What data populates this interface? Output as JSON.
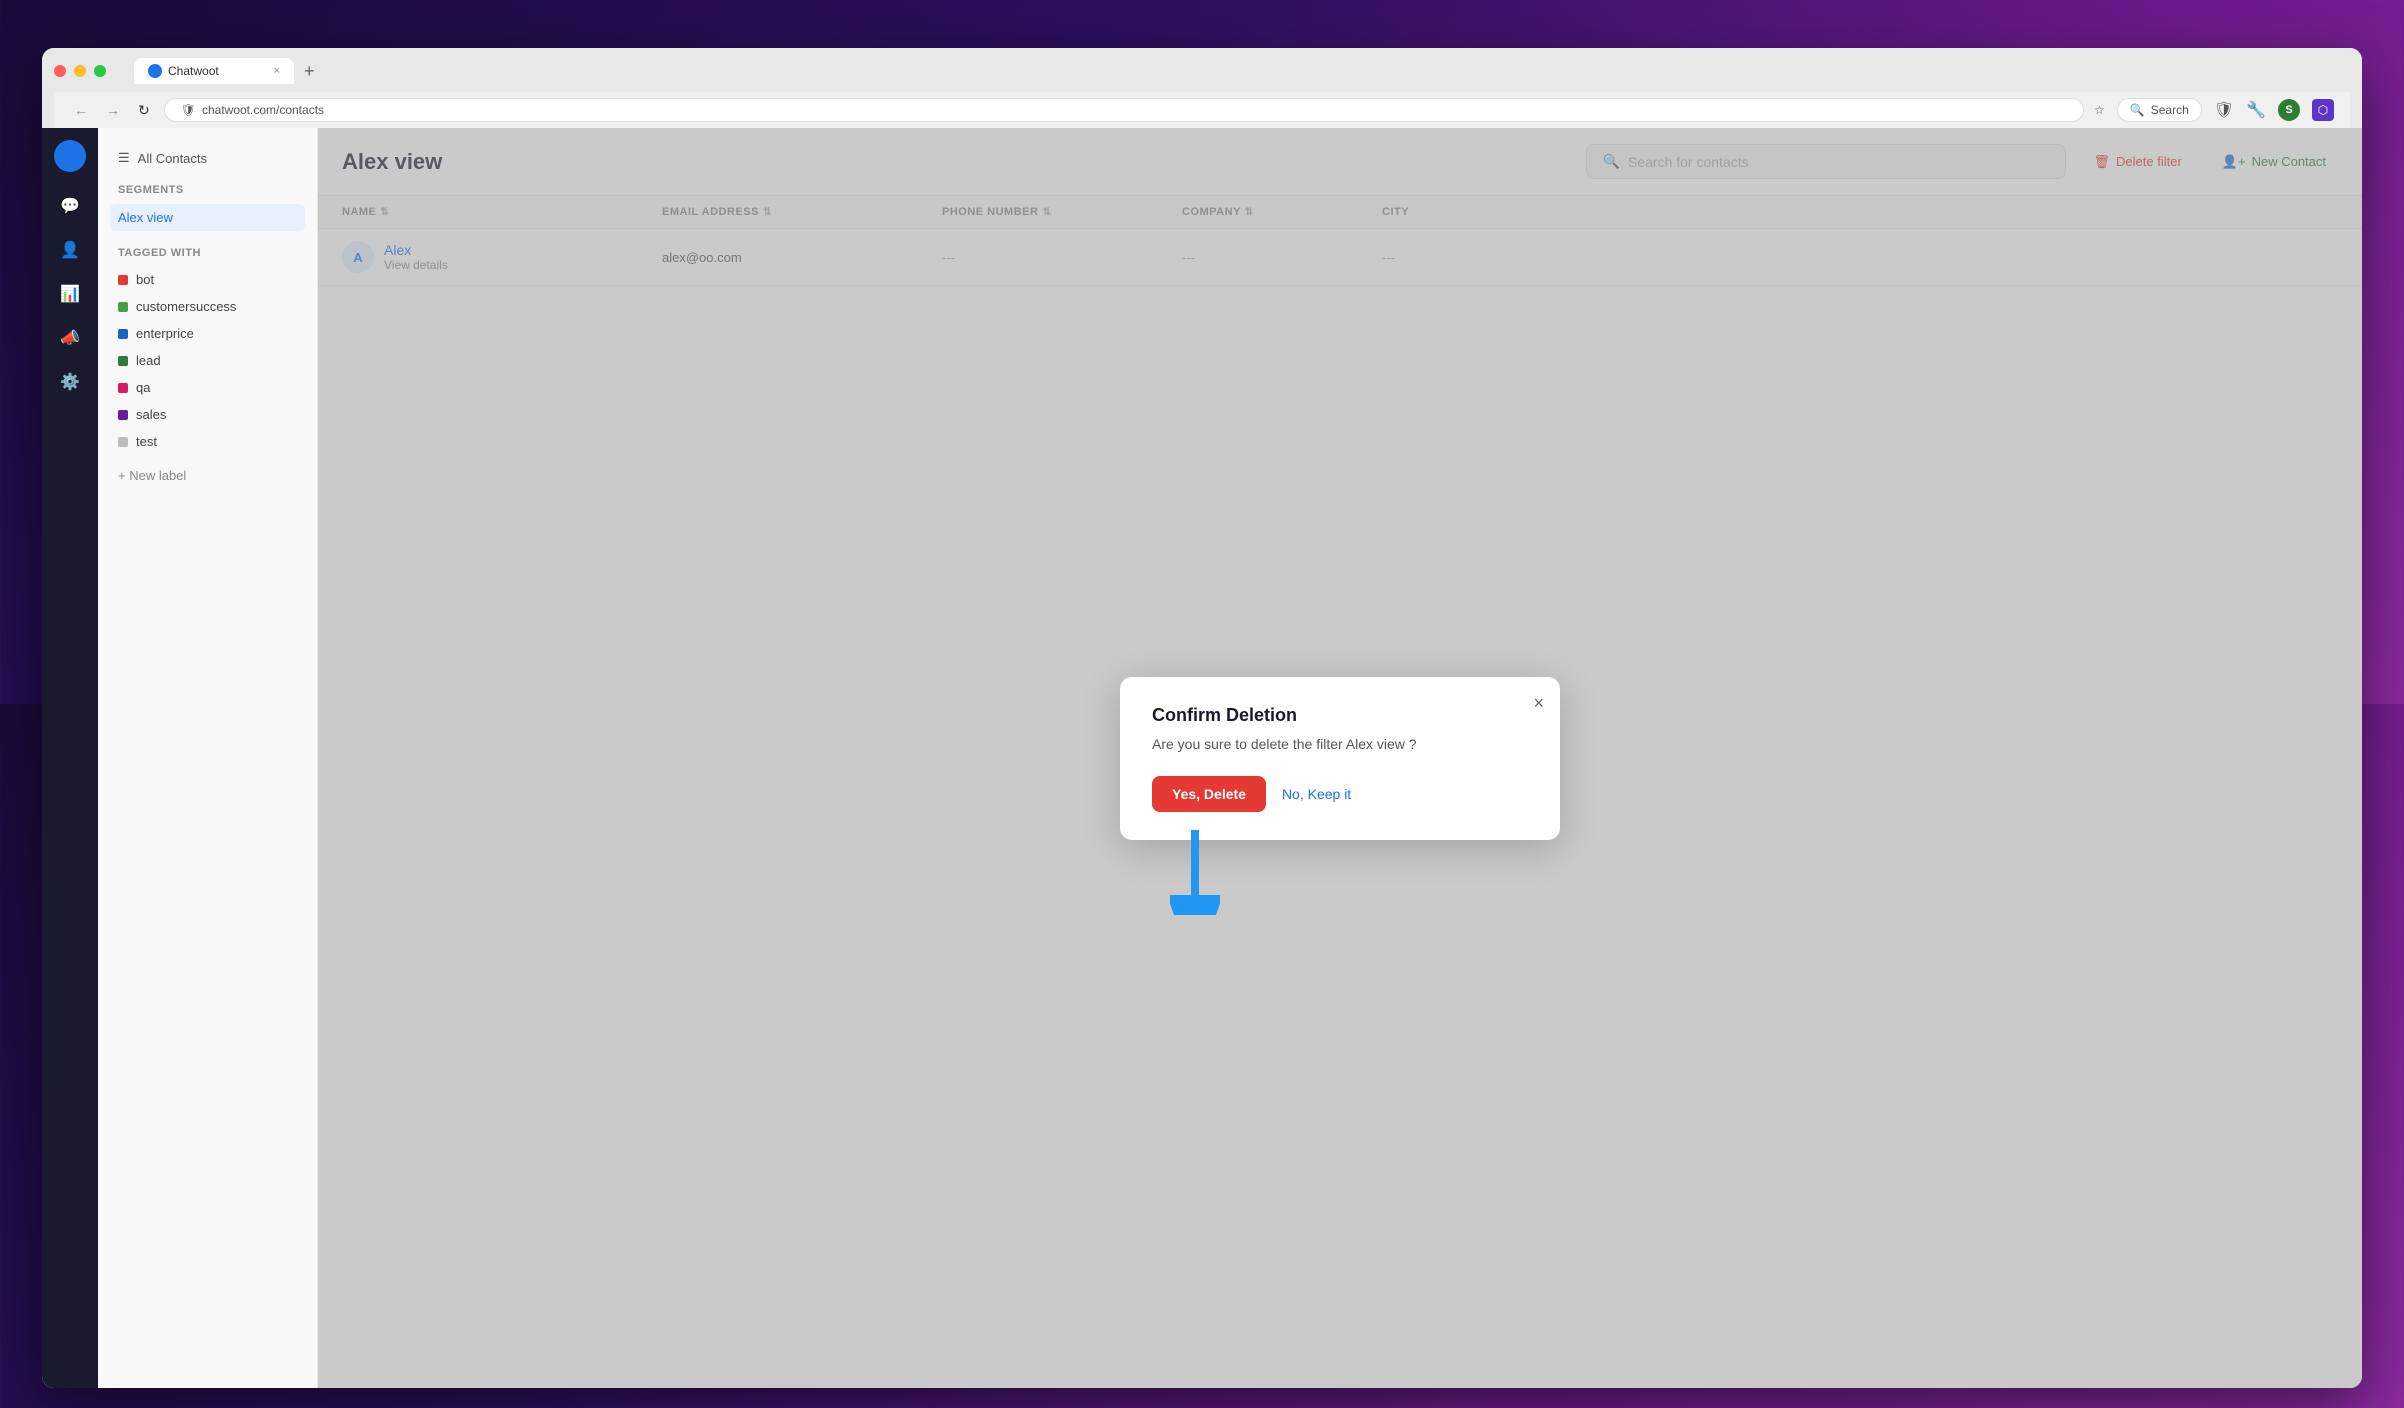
{
  "browser": {
    "tab_label": "Chatwoot",
    "tab_close": "×",
    "new_tab": "+",
    "nav_back": "←",
    "nav_forward": "→",
    "nav_refresh": "↻",
    "address_shield": "🛡",
    "address_doc": "📄",
    "search_placeholder": "Search",
    "star": "☆"
  },
  "sidebar": {
    "all_contacts_label": "All Contacts",
    "segments_title": "Segments",
    "active_segment": "Alex view",
    "tagged_with_title": "Tagged with",
    "labels": [
      {
        "name": "bot",
        "color": "#e53935"
      },
      {
        "name": "customersuccess",
        "color": "#43a047"
      },
      {
        "name": "enterprice",
        "color": "#1565c0"
      },
      {
        "name": "lead",
        "color": "#2e7d32"
      },
      {
        "name": "qa",
        "color": "#d81b60"
      },
      {
        "name": "sales",
        "color": "#6a1b9a"
      },
      {
        "name": "test",
        "color": "#bdbdbd"
      }
    ],
    "new_label_btn": "+ New label"
  },
  "main": {
    "page_title": "Alex view",
    "search_placeholder": "Search for contacts",
    "delete_filter_label": "Delete filter",
    "new_contact_label": "New Contact",
    "table": {
      "columns": [
        "NAME",
        "EMAIL ADDRESS",
        "PHONE NUMBER",
        "COMPANY",
        "CITY"
      ],
      "rows": [
        {
          "avatar_initials": "A",
          "name": "Alex",
          "subtitle": "View details",
          "email": "alex@oo.com",
          "phone": "---",
          "company": "---",
          "city": "---"
        }
      ]
    }
  },
  "modal": {
    "title": "Confirm Deletion",
    "body": "Are you sure to delete the filter Alex view ?",
    "confirm_label": "Yes, Delete",
    "cancel_label": "No, Keep it",
    "close_icon": "×"
  }
}
